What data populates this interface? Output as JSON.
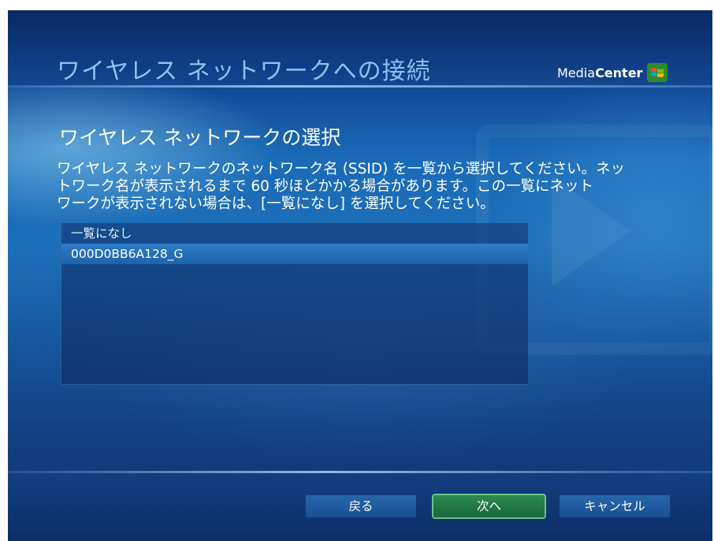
{
  "header": {
    "title": "ワイヤレス ネットワークへの接続",
    "logo_text_light": "Media",
    "logo_text_bold": "Center"
  },
  "main": {
    "heading": "ワイヤレス ネットワークの選択",
    "description_lines": [
      "ワイヤレス ネットワークのネットワーク名 (SSID) を一覧から選択してください。ネッ",
      "トワーク名が表示されるまで 60 秒ほどかかる場合があります。この一覧にネット",
      "ワークが表示されない場合は、[一覧になし] を選択してください。"
    ],
    "network_list": [
      {
        "label": "一覧になし",
        "selected": false
      },
      {
        "label": "000D0BB6A128_G",
        "selected": true
      }
    ]
  },
  "footer": {
    "back_label": "戻る",
    "next_label": "次へ",
    "cancel_label": "キャンセル"
  },
  "colors": {
    "background_blue": "#1e6fb9",
    "header_title": "#8fc1ee",
    "selected_row": "#2f7bc5",
    "next_button": "#2c8a52"
  },
  "icons": {
    "logo": "windows-flag-icon"
  }
}
